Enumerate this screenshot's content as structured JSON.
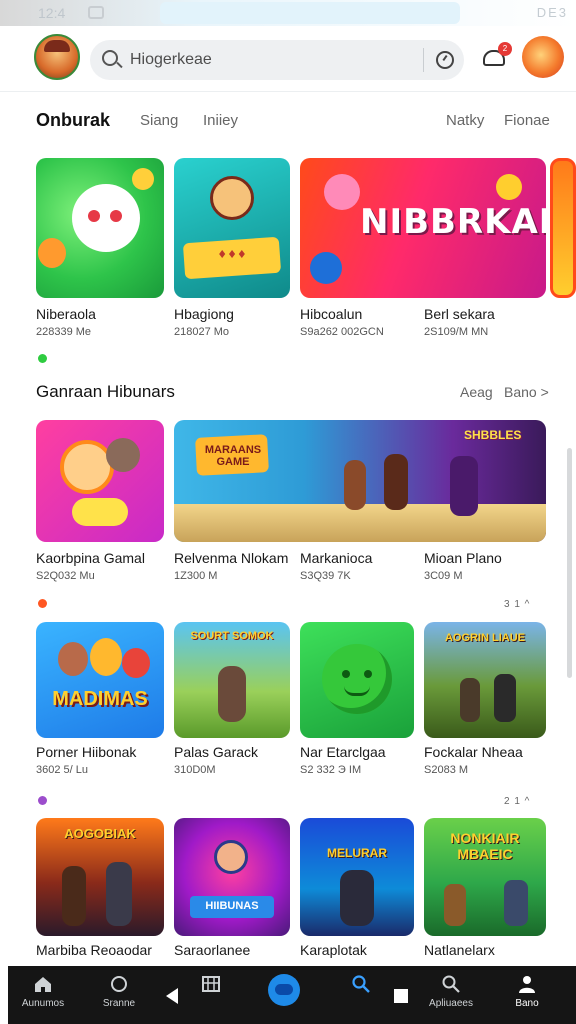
{
  "status_bar": {
    "time": "12:4",
    "right": "DE3"
  },
  "search": {
    "placeholder": "Hiogerkeae"
  },
  "notifications": {
    "badge": "2"
  },
  "tabs": [
    {
      "label": "Onburak",
      "active": true
    },
    {
      "label": "Siang",
      "active": false
    },
    {
      "label": "Iniiey",
      "active": false
    },
    {
      "label": "Natky",
      "active": false
    },
    {
      "label": "Fionae",
      "active": false
    }
  ],
  "row1": [
    {
      "name": "Niberaola",
      "size": "228339 Me",
      "colors": [
        "#2ec44a",
        "#8de05a"
      ]
    },
    {
      "name": "Hbagiong",
      "size": "218027 Mo",
      "colors": [
        "#21c6c3",
        "#f2d35a"
      ]
    },
    {
      "name": "Hibcoalun",
      "size": "S9a262 002GCN",
      "colors": [
        "#ff6b1a",
        "#d8128a"
      ]
    },
    {
      "name": "Berl sekara",
      "size": "2S109/M MN",
      "colors": [
        "#ff6b1a",
        "#d8128a"
      ]
    }
  ],
  "banner_title": "NIBBRKAN",
  "section2": {
    "title": "Ganraan Hibunars",
    "links": [
      "Aeag",
      "Bano >"
    ]
  },
  "row2": [
    {
      "name": "Kaorbpina Gamal",
      "size": "S2Q032 Mu",
      "colors": [
        "#ff3fa0",
        "#ffb347"
      ]
    },
    {
      "name": "Relvenma Nlokam",
      "size": "1Z300 M",
      "colors": [
        "#2e9bd6",
        "#5b2a8c"
      ]
    },
    {
      "name": "Markanioca",
      "size": "S3Q39 7K",
      "colors": [
        "#2e9bd6",
        "#5b2a8c"
      ]
    },
    {
      "name": "Mioan Plano",
      "size": "3C09 M",
      "colors": [
        "#2e9bd6",
        "#5b2a8c"
      ]
    }
  ],
  "game_banner_left": "MARAANS GAME",
  "game_banner_right": "SHBBLES",
  "pager1": "3 1 ^",
  "row3": [
    {
      "name": "Porner Hiibonak",
      "size": "3602 5/ Lu",
      "colors": [
        "#1e9bff",
        "#ffce2e"
      ]
    },
    {
      "name": "Palas Garack",
      "size": "310D0M",
      "colors": [
        "#3bb4f2",
        "#7fbf3a"
      ]
    },
    {
      "name": "Nar Etarclgaa",
      "size": "S2 332 Э IM",
      "colors": [
        "#2ecc40",
        "#1aa13a"
      ]
    },
    {
      "name": "Fockalar Nheaa",
      "size": "S2083 M",
      "colors": [
        "#5aa0d8",
        "#6a8b2a"
      ]
    }
  ],
  "thumb_titles": {
    "r3c1": "MADIMAS",
    "r3c2": "SOURT SOMOK",
    "r3c4": "AOGRIN LIAUE"
  },
  "pager2": "2 1 ^",
  "row4": [
    {
      "name": "Marbiba Reoaodar",
      "size": "",
      "colors": [
        "#ff6a1a",
        "#3a1a4a"
      ]
    },
    {
      "name": "Saraorlanee",
      "size": "",
      "colors": [
        "#a01ac8",
        "#ff3fa0"
      ]
    },
    {
      "name": "Karaplotak",
      "size": "",
      "colors": [
        "#1a4bd8",
        "#0e8bd8"
      ]
    },
    {
      "name": "Natlanelarx",
      "size": "",
      "colors": [
        "#2ea84a",
        "#ffce2e"
      ]
    }
  ],
  "thumb_titles2": {
    "r4c1": "AOGOBIAK",
    "r4c2": "HIIBUNAS",
    "r4c3": "MELURAR",
    "r4c4": "NONKIAIR MBAEIC"
  },
  "dot_colors": {
    "dot1": "#2ecc40",
    "dot2": "#ff5722",
    "dot3": "#9c4dcc"
  },
  "bottom_nav": [
    {
      "label": "Aunumos",
      "icon": "home-icon"
    },
    {
      "label": "Sranne",
      "icon": "circle-icon"
    },
    {
      "label": "",
      "icon": "back-triangle-icon"
    },
    {
      "label": "",
      "icon": "film-icon"
    },
    {
      "label": "",
      "icon": "cloud-icon"
    },
    {
      "label": "",
      "icon": "search-icon"
    },
    {
      "label": "",
      "icon": "square-icon"
    },
    {
      "label": "Apliuaees",
      "icon": "search-icon"
    },
    {
      "label": "Bano",
      "icon": "profile-icon"
    }
  ]
}
